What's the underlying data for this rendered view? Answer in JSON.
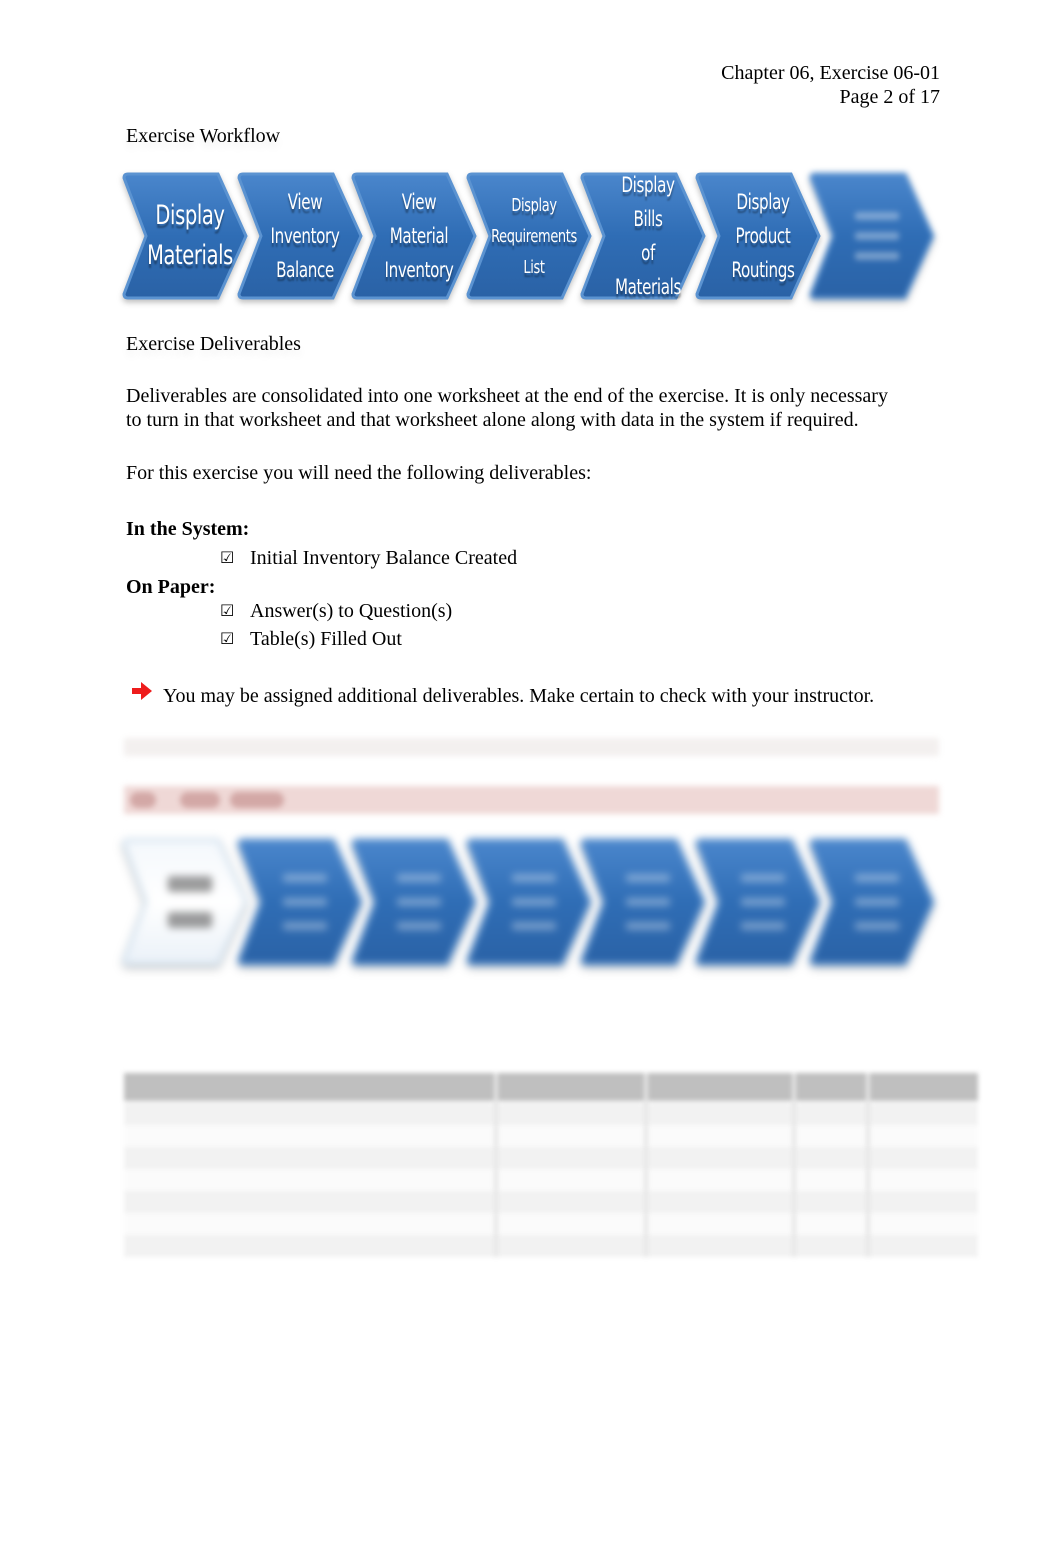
{
  "header": {
    "chapter_line": "Chapter 06, Exercise 06-01",
    "page_line": "Page 2 of 17"
  },
  "workflow": {
    "heading": "Exercise Workflow",
    "steps": [
      {
        "label": "Display\nMaterials",
        "state": "current"
      },
      {
        "label": "View\nInventory\nBalance",
        "state": "normal"
      },
      {
        "label": "View\nMaterial\nInventory",
        "state": "normal"
      },
      {
        "label": "Display\nRequirements\nList",
        "state": "normal"
      },
      {
        "label": "Display Bills\nof Materials",
        "state": "normal"
      },
      {
        "label": "Display\nProduct\nRoutings",
        "state": "normal"
      },
      {
        "label": "",
        "state": "obscured"
      }
    ],
    "colors": {
      "chevron_fill": "#2f6db5",
      "chevron_highlight": "#4a86cc"
    }
  },
  "deliverables": {
    "heading": "Exercise Deliverables",
    "intro_line1": "Deliverables are consolidated into one worksheet at the end of the exercise. It is only necessary",
    "intro_line2": "to turn in that worksheet and that worksheet alone along with data in the system if required.",
    "lead": "For this exercise you will need the following deliverables:",
    "groups": [
      {
        "title": "In the System:",
        "items": [
          "Initial Inventory Balance Created"
        ]
      },
      {
        "title": "On Paper:",
        "items": [
          "Answer(s) to Question(s)",
          "Table(s) Filled Out"
        ]
      }
    ],
    "check_glyph": "☑",
    "note": "You may be assigned additional deliverables. Make certain to check with your instructor.",
    "note_icon_color": "#ee1c1c"
  },
  "obscured": {
    "step_banner_color": "#efd8d6",
    "table_header_color": "#bfbfbf"
  }
}
